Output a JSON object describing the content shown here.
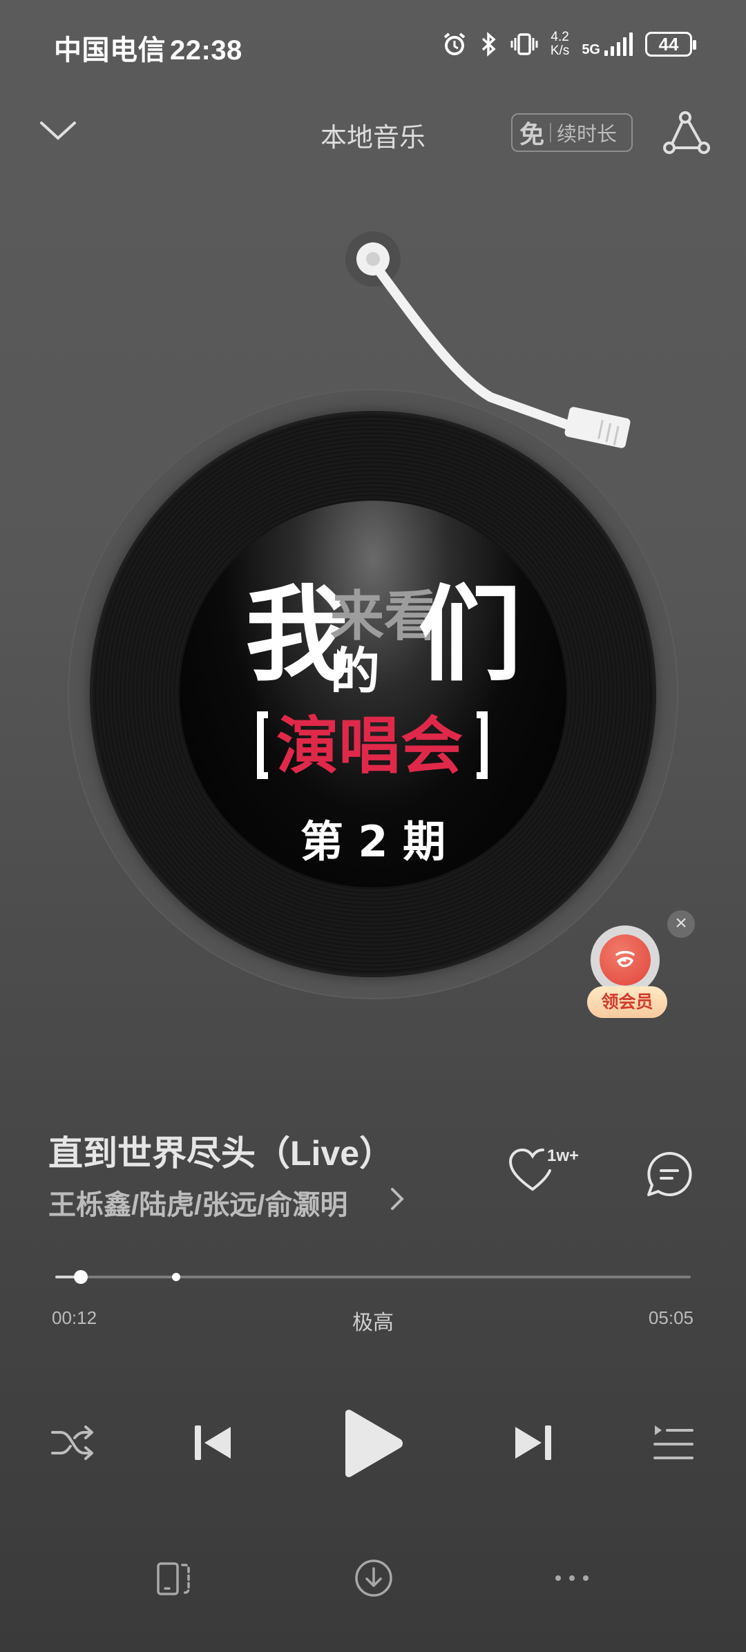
{
  "status_bar": {
    "carrier": "中国电信",
    "time": "22:38",
    "net_speed_value": "4.2",
    "net_speed_unit": "K/s",
    "network_type": "5G",
    "battery": "44"
  },
  "header": {
    "title": "本地音乐",
    "vip_free_label": "免",
    "vip_text": "续时长"
  },
  "album_art": {
    "line_wo": "我",
    "line_laikan": "来看",
    "line_de": "的",
    "line_men": "们",
    "line_yanchang": "演唱会",
    "episode": "第 2 期"
  },
  "vip_float": {
    "badge": "领会员",
    "close": "×"
  },
  "song": {
    "title": "直到世界尽头（Live）",
    "artists": "王栎鑫/陆虎/张远/俞灏明",
    "like_count": "1w+"
  },
  "progress": {
    "current": "00:12",
    "quality": "极高",
    "duration": "05:05",
    "played_fraction": 0.04,
    "buffered_fraction": 0.19
  },
  "colors": {
    "accent_red": "#e0294a",
    "vip_badge": "#f7caa0"
  }
}
